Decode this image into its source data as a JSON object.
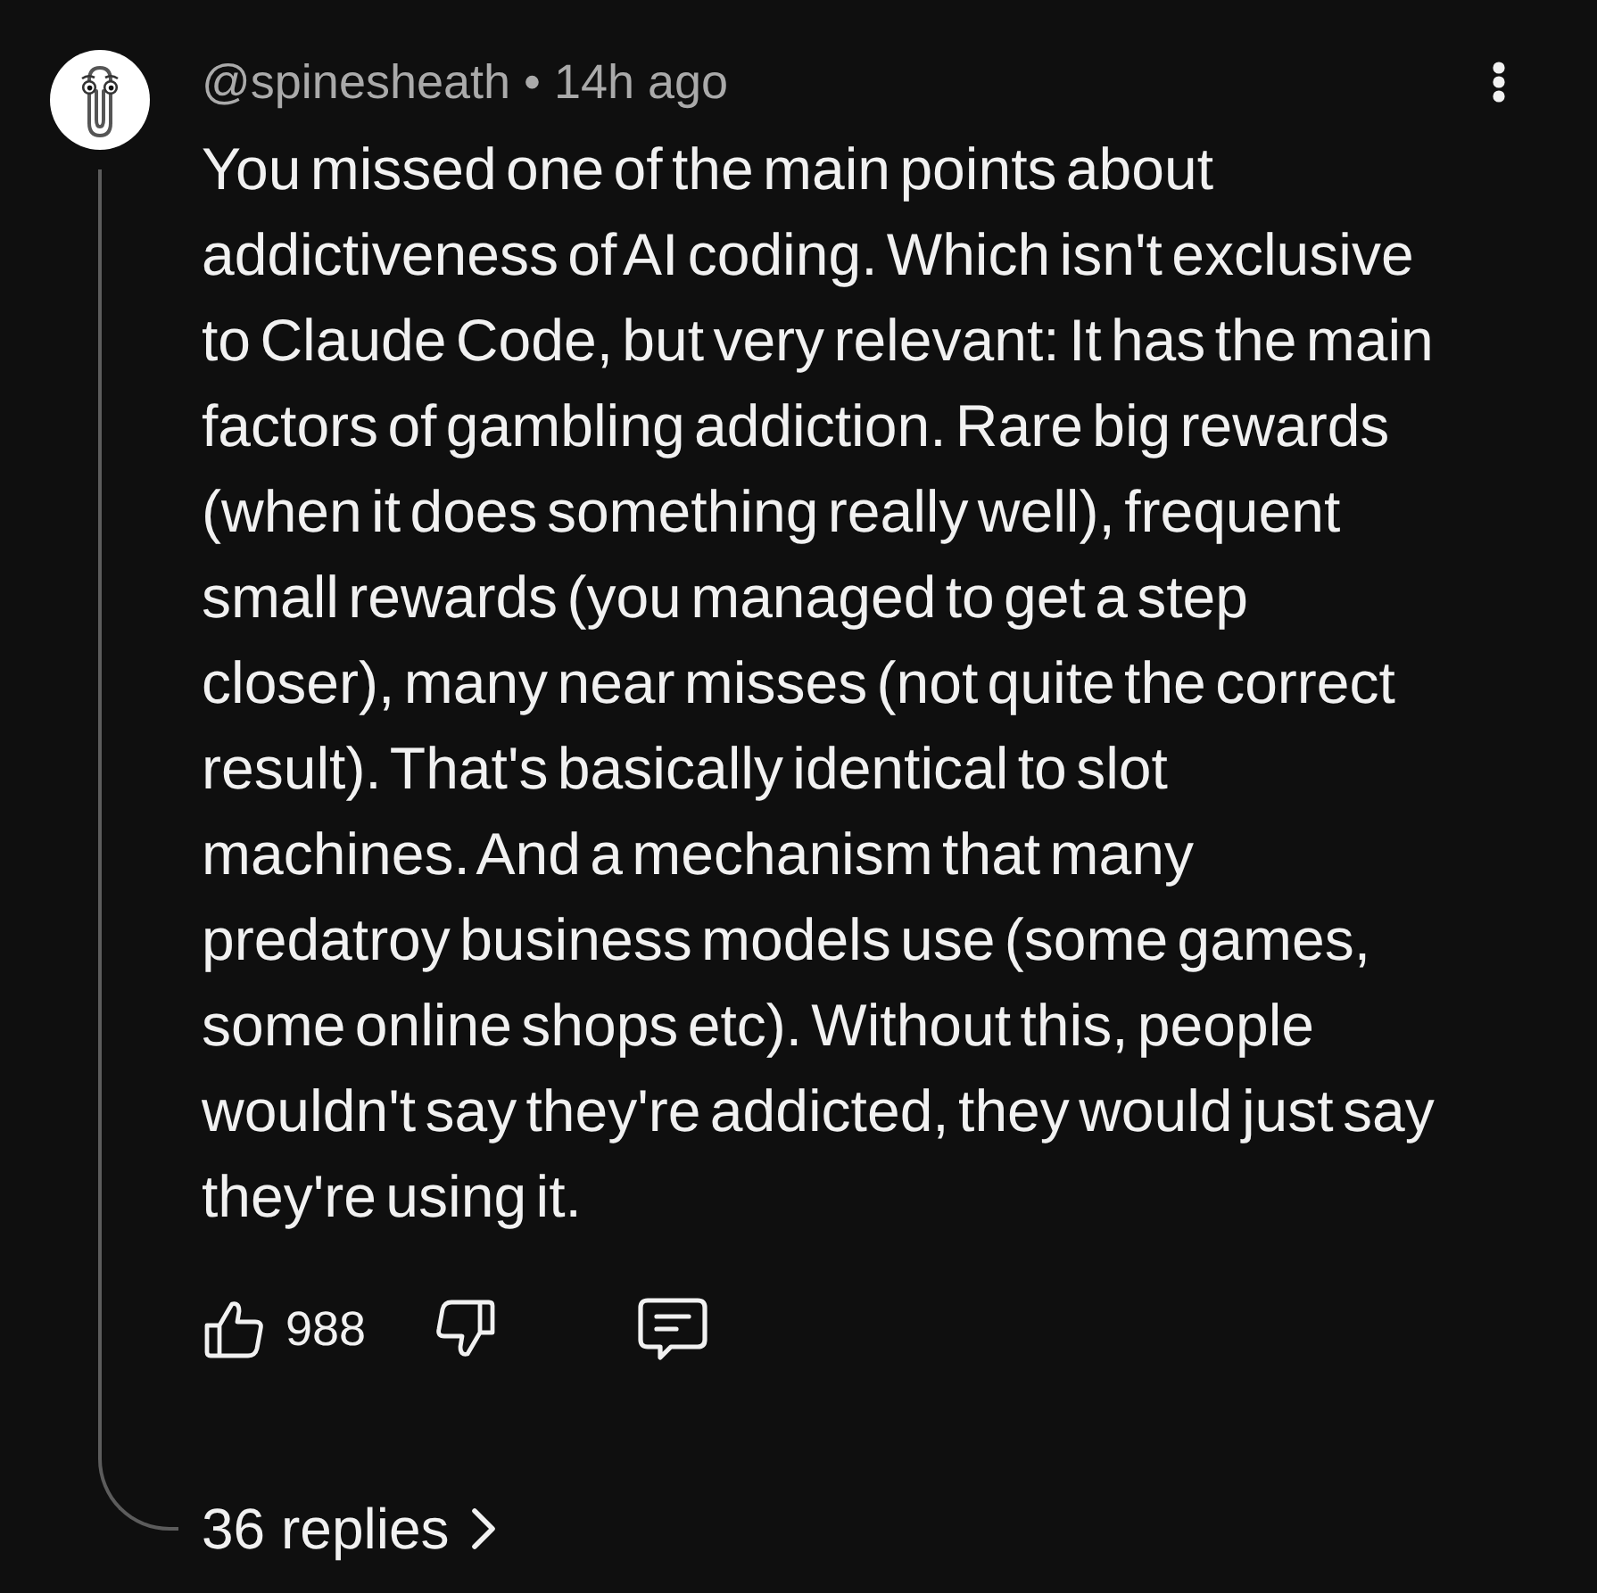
{
  "comment": {
    "author": "@spinesheath",
    "separator": "•",
    "time": "14h ago",
    "text": "You missed one of the main points about addictiveness of AI coding. Which isn't exclusive to Claude Code, but very relevant: It has the main factors of gambling addiction. Rare big rewards (when it does something really well), frequent small rewards (you managed to get a step closer), many near misses (not quite the correct result). That's basically identical to slot machines. And a mechanism that many predatroy business models use (some games, some online shops etc). Without this, people wouldn't say they're addicted, they would just say they're using it.",
    "likes": "988",
    "replies": "36 replies"
  }
}
